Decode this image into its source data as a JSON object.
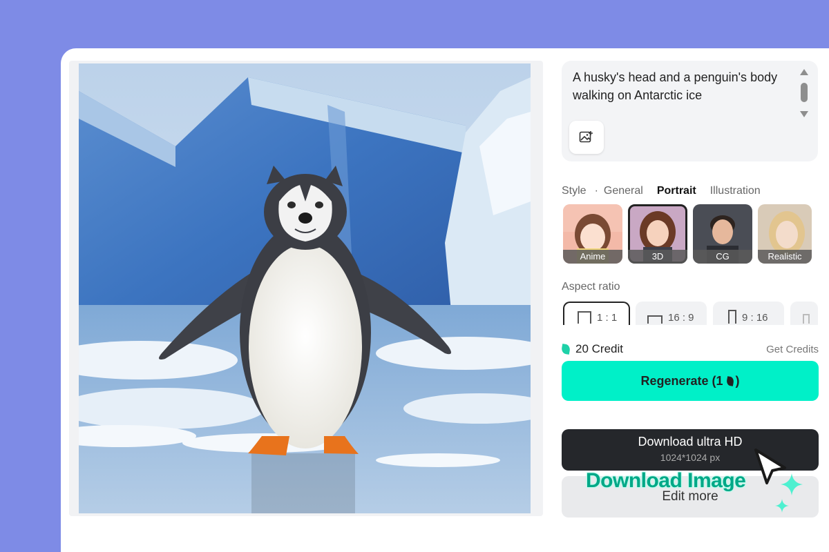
{
  "prompt": {
    "text": "A husky's head and a penguin's body walking on Antarctic ice"
  },
  "style": {
    "label": "Style",
    "tabs": [
      "General",
      "Portrait",
      "Illustration"
    ],
    "active_tab": "Portrait",
    "options": [
      {
        "label": "Anime"
      },
      {
        "label": "3D",
        "selected": true
      },
      {
        "label": "CG"
      },
      {
        "label": "Realistic"
      }
    ]
  },
  "aspect": {
    "label": "Aspect ratio",
    "options": [
      {
        "label": "1 : 1",
        "selected": true
      },
      {
        "label": "16 : 9"
      },
      {
        "label": "9 : 16"
      }
    ]
  },
  "credits": {
    "balance": "20 Credit",
    "get_label": "Get Credits"
  },
  "regenerate": {
    "label": "Regenerate (1",
    "suffix": ")"
  },
  "download": {
    "title": "Download ultra HD",
    "subtitle": "1024*1024 px"
  },
  "edit": {
    "label": "Edit more"
  },
  "overlay": {
    "caption": "Download Image"
  },
  "colors": {
    "background": "#7e8be6",
    "accent": "#00f0c8",
    "dark_button": "#25272b"
  }
}
